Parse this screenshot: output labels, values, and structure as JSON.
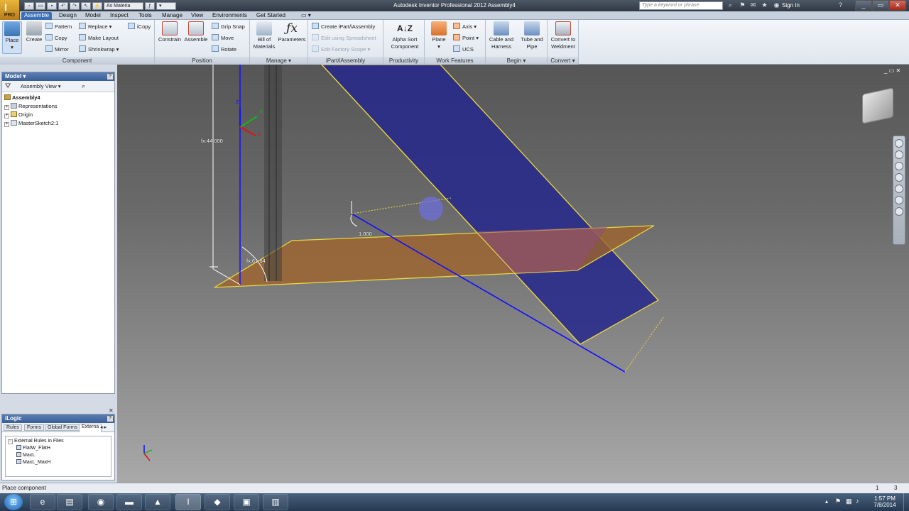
{
  "titlebar": {
    "app_title": "Autodesk Inventor Professional 2012   Assembly4",
    "product_badge": "PRO",
    "material_select": "As Materia",
    "search_placeholder": "Type a keyword or phrase",
    "sign_in": "Sign In"
  },
  "tabs": [
    "Assemble",
    "Design",
    "Model",
    "Inspect",
    "Tools",
    "Manage",
    "View",
    "Environments",
    "Get Started"
  ],
  "ribbon": {
    "component": {
      "label": "Component",
      "place": "Place",
      "create": "Create",
      "pattern": "Pattern",
      "copy": "Copy",
      "mirror": "Mirror",
      "replace": "Replace",
      "make_layout": "Make Layout",
      "shrinkwrap": "Shrinkwrap",
      "icopy": "iCopy"
    },
    "position": {
      "label": "Position",
      "constrain": "Constrain",
      "assemble": "Assemble",
      "grip_snap": "Grip Snap",
      "move": "Move",
      "rotate": "Rotate"
    },
    "manage": {
      "label": "Manage",
      "bill_of_materials": "Bill of Materials",
      "parameters": "Parameters"
    },
    "ipart": {
      "label": "iPart/iAssembly",
      "create": "Create iPart/iAssembly",
      "edit_spreadsheet": "Edit using Spreadsheet",
      "edit_factory_scope": "Edit Factory Scope"
    },
    "productivity": {
      "label": "Productivity",
      "alpha_sort": "Alpha Sort Component"
    },
    "work_features": {
      "label": "Work Features",
      "plane": "Plane",
      "axis": "Axis",
      "point": "Point",
      "ucs": "UCS"
    },
    "begin": {
      "label": "Begin",
      "cable_harness": "Cable and Harness",
      "tube_pipe": "Tube and Pipe"
    },
    "convert": {
      "label": "Convert",
      "convert_weldment": "Convert to Weldment"
    }
  },
  "model_panel": {
    "title": "Model",
    "view_select": "Assembly View",
    "tree": [
      "Assembly4",
      "Representations",
      "Origin",
      "MasterSketch2:1"
    ]
  },
  "ilogic_panel": {
    "title": "iLogic",
    "tabs": [
      "Rules",
      "Forms",
      "Global Forms",
      "Externa"
    ],
    "tree": [
      "External Rules in Files",
      "FlatW_FlatH",
      "MaxL",
      "MaxL_MaxH"
    ]
  },
  "viewport": {
    "dimension_1": "fx:44.000",
    "dimension_2": "fx:61.64",
    "dimension_3": "1.000",
    "triad_y": "Y",
    "triad_z": "Z",
    "triad_x": "X"
  },
  "status": {
    "message": "Place component",
    "count_1": "1",
    "count_2": "3"
  },
  "taskbar": {
    "time": "1:57 PM",
    "date": "7/8/2014"
  },
  "colors": {
    "plane_blue": "#26288c",
    "plane_orange": "#a0642a",
    "edge_yellow": "#e8d640",
    "axis_blue": "#1010ff",
    "ribbon_tab_active": "#3b6fb7"
  }
}
